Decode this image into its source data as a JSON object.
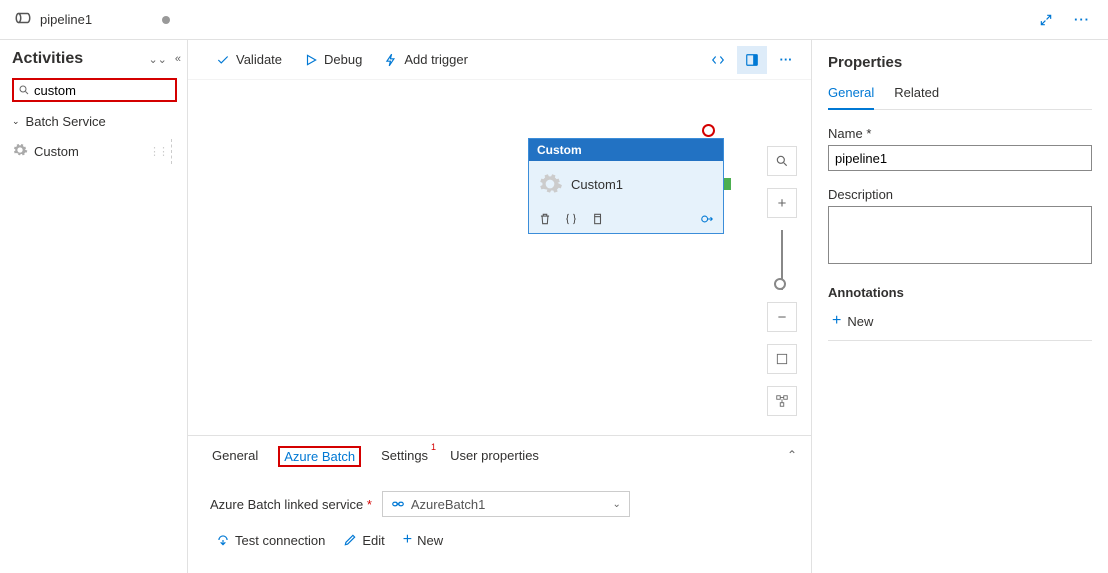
{
  "header": {
    "pipeline_name": "pipeline1"
  },
  "activities_panel": {
    "title": "Activities",
    "search_value": "custom",
    "category": "Batch Service",
    "item": "Custom"
  },
  "toolbar": {
    "validate": "Validate",
    "debug": "Debug",
    "add_trigger": "Add trigger"
  },
  "node": {
    "type_label": "Custom",
    "name": "Custom1"
  },
  "bottom": {
    "tabs": {
      "general": "General",
      "azure_batch": "Azure Batch",
      "settings": "Settings",
      "settings_badge": "1",
      "user_props": "User properties"
    },
    "linked_label": "Azure Batch linked service",
    "linked_value": "AzureBatch1",
    "actions": {
      "test": "Test connection",
      "edit": "Edit",
      "new": "New"
    }
  },
  "props": {
    "title": "Properties",
    "tabs": {
      "general": "General",
      "related": "Related"
    },
    "name_label": "Name",
    "name_value": "pipeline1",
    "desc_label": "Description",
    "annotations_label": "Annotations",
    "new_label": "New"
  }
}
